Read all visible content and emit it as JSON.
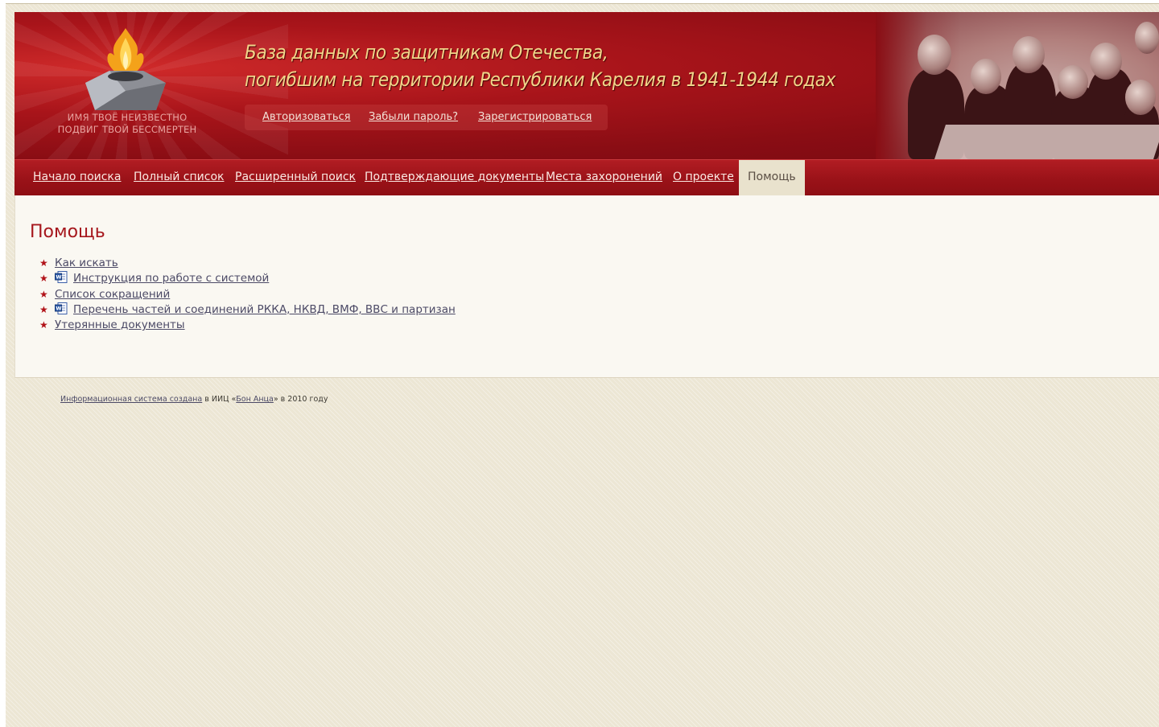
{
  "header": {
    "logo_motto_line1": "ИМЯ ТВОЁ НЕИЗВЕСТНО",
    "logo_motto_line2": "ПОДВИГ ТВОЙ БЕССМЕРТЕН",
    "title_line1": "База данных по защитникам Отечества,",
    "title_line2": "погибшим на территории Республики Карелия в 1941-1944 годах",
    "auth_links": {
      "login": "Авторизоваться",
      "forgot": "Забыли пароль?",
      "register": "Зарегистрироваться"
    }
  },
  "nav": {
    "items": [
      {
        "label": "Начало поиска"
      },
      {
        "label": "Полный список"
      },
      {
        "label": "Расширенный поиск"
      },
      {
        "label": "Подтверждающие документы"
      },
      {
        "label": "Места захоронений"
      },
      {
        "label": "О проекте"
      }
    ],
    "active_label": "Помощь"
  },
  "main": {
    "heading": "Помощь",
    "items": [
      {
        "label": "Как искать",
        "icon": ""
      },
      {
        "label": "Инструкция по работе с системой",
        "icon": "word-doc-icon"
      },
      {
        "label": "Список сокращений",
        "icon": ""
      },
      {
        "label": "Перечень частей и соединений РККА, НКВД, ВМФ, ВВС и партизан",
        "icon": "word-doc-icon"
      },
      {
        "label": "Утерянные документы",
        "icon": ""
      }
    ]
  },
  "footer": {
    "link1": "Информационная система создана",
    "text1": " в ИИЦ «",
    "link2": "Бон Анца",
    "text2": "» в 2010 году"
  },
  "colors": {
    "header_red": "#8a0d14",
    "title_gold": "#f1d68a",
    "heading_red": "#a6171d",
    "star_red": "#b11218",
    "link_color": "#4c4a66",
    "background": "#ece6d4"
  }
}
